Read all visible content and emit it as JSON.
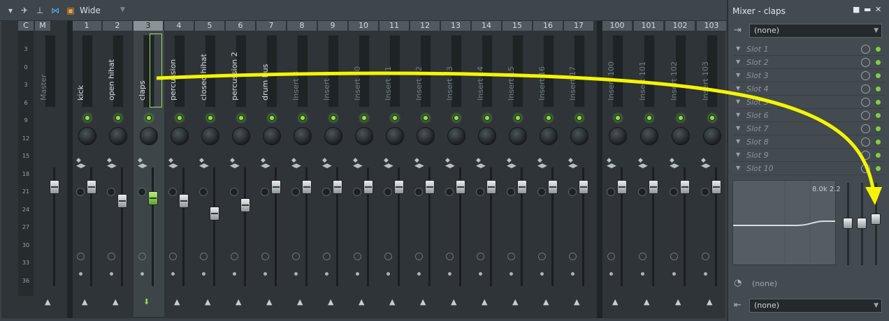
{
  "toolbar": {
    "title": "Wide",
    "icons": [
      "chevron-down-icon",
      "wand-icon",
      "pin-icon",
      "snap-icon",
      "window-icon"
    ]
  },
  "mixer": {
    "headers": [
      "C",
      "M",
      "1",
      "2",
      "3",
      "4",
      "5",
      "6",
      "7",
      "8",
      "9",
      "10",
      "11",
      "12",
      "13",
      "14",
      "15",
      "16",
      "17",
      "100",
      "101",
      "102",
      "103"
    ],
    "scale": [
      "3",
      "0",
      "3",
      "6",
      "9",
      "12",
      "15",
      "18",
      "21",
      "24",
      "27",
      "30",
      "33",
      "36"
    ],
    "master_label": "Master",
    "tracks": [
      {
        "num": "1",
        "name": "kick"
      },
      {
        "num": "2",
        "name": "open hihat"
      },
      {
        "num": "3",
        "name": "claps"
      },
      {
        "num": "4",
        "name": "percussion"
      },
      {
        "num": "5",
        "name": "closed hihat"
      },
      {
        "num": "6",
        "name": "percussion 2"
      },
      {
        "num": "7",
        "name": "drum bus"
      },
      {
        "num": "8",
        "name": "Insert 8"
      },
      {
        "num": "9",
        "name": "Insert 9"
      },
      {
        "num": "10",
        "name": "Insert 10"
      },
      {
        "num": "11",
        "name": "Insert 11"
      },
      {
        "num": "12",
        "name": "Insert 12"
      },
      {
        "num": "13",
        "name": "Insert 13"
      },
      {
        "num": "14",
        "name": "Insert 14"
      },
      {
        "num": "15",
        "name": "Insert 15"
      },
      {
        "num": "16",
        "name": "Insert 16"
      },
      {
        "num": "17",
        "name": "Insert 17"
      }
    ],
    "extra_tracks": [
      {
        "num": "100",
        "name": "Insert 100"
      },
      {
        "num": "101",
        "name": "Insert 101"
      },
      {
        "num": "102",
        "name": "Insert 102"
      },
      {
        "num": "103",
        "name": "Insert 103"
      }
    ]
  },
  "panel": {
    "title": "Mixer - claps",
    "input": "(none)",
    "slots": [
      "Slot 1",
      "Slot 2",
      "Slot 3",
      "Slot 4",
      "Slot 5",
      "Slot 6",
      "Slot 7",
      "Slot 8",
      "Slot 9",
      "Slot 10"
    ],
    "eq_readout": "8.0k 2.2",
    "send_label": "(none)",
    "output": "(none)"
  },
  "colors": {
    "accent": "#8ee04a",
    "annotation": "#f5f500"
  }
}
